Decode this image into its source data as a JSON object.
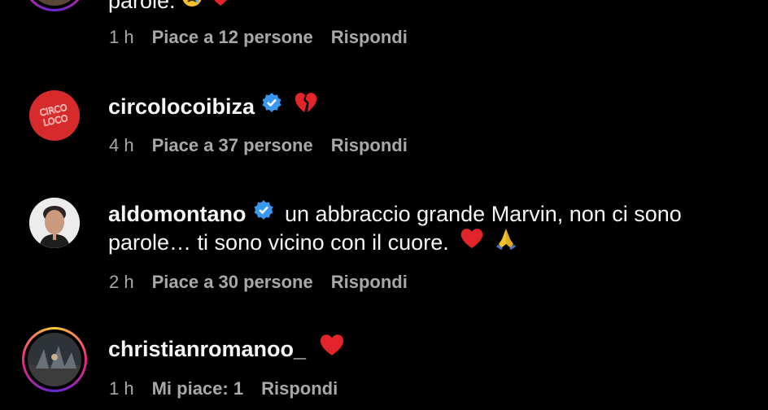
{
  "comments": [
    {
      "username": "",
      "text": "parole.",
      "time": "1 h",
      "likes": "Piace a 12 persone",
      "reply": "Rispondi"
    },
    {
      "username": "circolocoibiza",
      "text": "",
      "emoji": "broken-heart",
      "time": "4 h",
      "likes": "Piace a 37 persone",
      "reply": "Rispondi",
      "avatar_text": "CIRCO LOCO",
      "verified": true
    },
    {
      "username": "aldomontano",
      "text_line1": "un abbraccio grande Marvin, non ci sono",
      "text_line2": "parole… ti sono vicino con il cuore.",
      "time": "2 h",
      "likes": "Piace a 30 persone",
      "reply": "Rispondi",
      "verified": true
    },
    {
      "username": "christianromanoo_",
      "text": "",
      "emoji": "red-heart",
      "time": "1 h",
      "likes": "Mi piace: 1",
      "reply": "Rispondi"
    }
  ],
  "colors": {
    "background": "#000000",
    "text": "#f5f5f5",
    "meta": "#a8a8a8",
    "verified": "#3897f0",
    "heart": "#e3242b",
    "circoloco_bg": "#d72a2a"
  }
}
